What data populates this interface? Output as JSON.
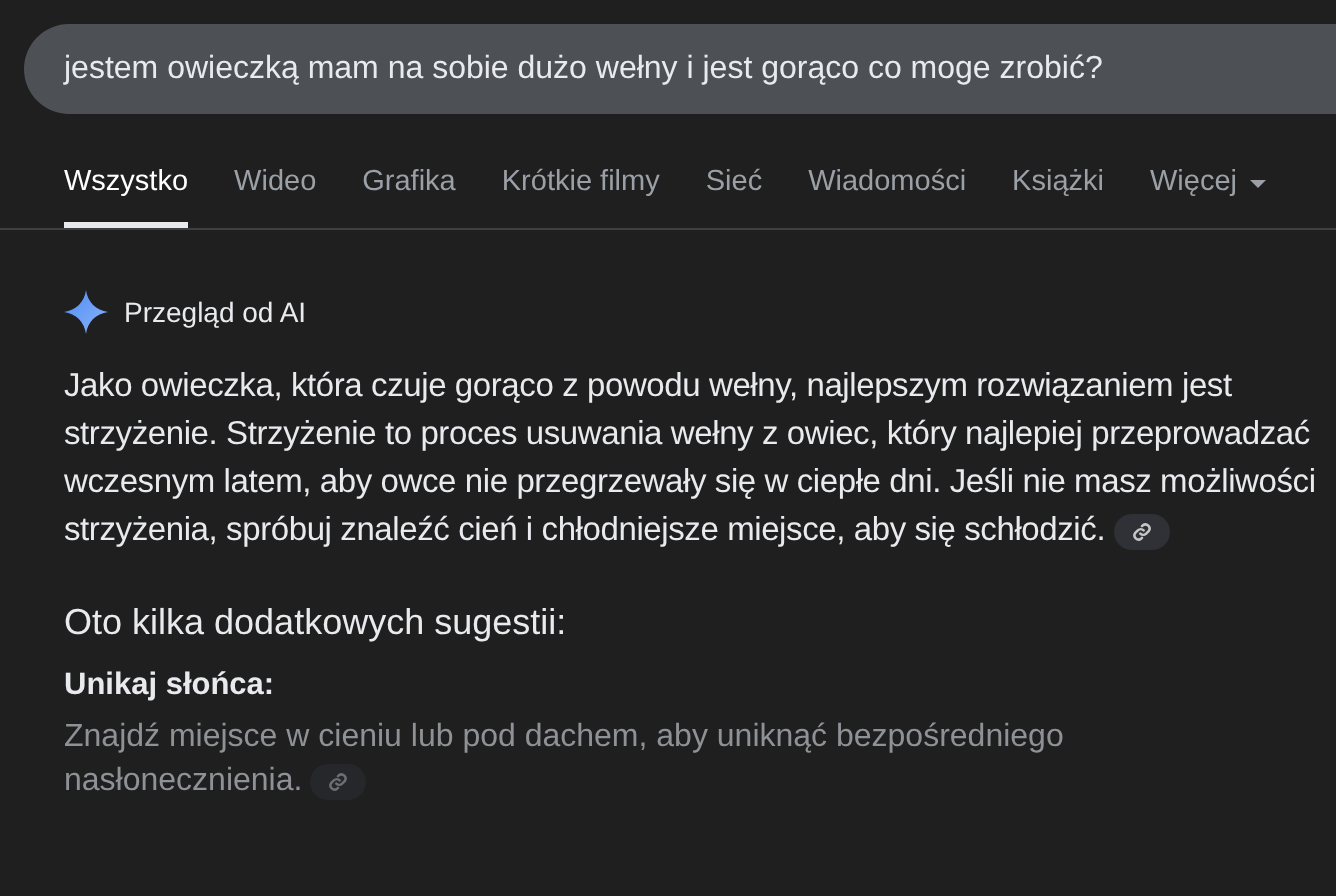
{
  "search": {
    "value": "jestem owieczką mam na sobie dużo wełny i jest gorąco co moge zrobić?"
  },
  "tabs": [
    {
      "label": "Wszystko",
      "selected": true,
      "kind": "tab"
    },
    {
      "label": "Wideo",
      "selected": false,
      "kind": "tab"
    },
    {
      "label": "Grafika",
      "selected": false,
      "kind": "tab"
    },
    {
      "label": "Krótkie filmy",
      "selected": false,
      "kind": "tab"
    },
    {
      "label": "Sieć",
      "selected": false,
      "kind": "tab"
    },
    {
      "label": "Wiadomości",
      "selected": false,
      "kind": "tab"
    },
    {
      "label": "Książki",
      "selected": false,
      "kind": "tab"
    },
    {
      "label": "Więcej",
      "selected": false,
      "kind": "menu"
    }
  ],
  "ai_overview": {
    "title": "Przegląd od AI",
    "summary": "Jako owieczka, która czuje gorąco z powodu wełny, najlepszym rozwiązaniem jest strzyżenie. Strzyżenie to proces usuwania wełny z owiec, który najlepiej przeprowadzać wczesnym latem, aby owce nie przegrzewały się w ciepłe dni. Jeśli nie masz możliwości strzyżenia, spróbuj znaleźć cień i chłodniejsze miejsce, aby się schłodzić.",
    "subheading": "Oto kilka dodatkowych sugestii:",
    "suggestions": [
      {
        "title": "Unikaj słońca:",
        "text": "Znajdź miejsce w cieniu lub pod dachem, aby uniknąć bezpośredniego nasłonecznienia."
      }
    ]
  }
}
